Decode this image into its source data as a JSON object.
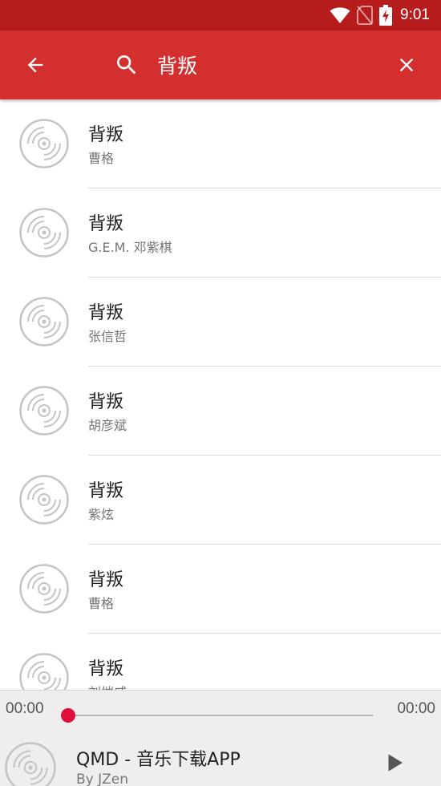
{
  "status_bar": {
    "time": "9:01",
    "icons": [
      "wifi-icon",
      "no-sim-icon",
      "battery-charging-icon"
    ],
    "background": "#b71c1c"
  },
  "app_bar": {
    "background": "#d32f2f",
    "back_icon": "arrow-left-icon",
    "search_icon": "search-icon",
    "search_value": "背叛",
    "close_icon": "close-icon"
  },
  "results": [
    {
      "title": "背叛",
      "artist": "曹格",
      "icon": "disc-icon"
    },
    {
      "title": "背叛",
      "artist": "G.E.M. 邓紫棋",
      "icon": "disc-icon"
    },
    {
      "title": "背叛",
      "artist": "张信哲",
      "icon": "disc-icon"
    },
    {
      "title": "背叛",
      "artist": "胡彦斌",
      "icon": "disc-icon"
    },
    {
      "title": "背叛",
      "artist": "紫炫",
      "icon": "disc-icon"
    },
    {
      "title": "背叛",
      "artist": "曹格",
      "icon": "disc-icon"
    },
    {
      "title": "背叛",
      "artist": "刘恺威",
      "icon": "disc-icon"
    }
  ],
  "player": {
    "current_time": "00:00",
    "total_time": "00:00",
    "progress": 0,
    "accent": "#e0103a",
    "title": "QMD - 音乐下载APP",
    "subtitle": "By JZen",
    "play_icon": "play-icon"
  }
}
